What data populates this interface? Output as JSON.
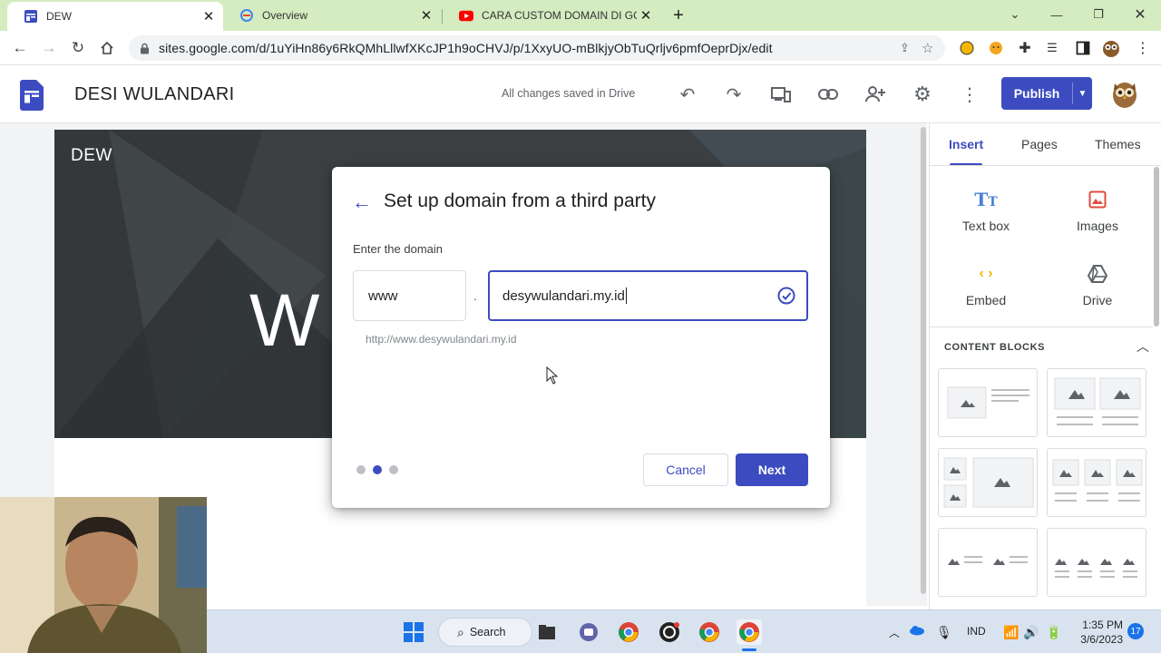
{
  "browser": {
    "tabs": [
      {
        "title": "DEW",
        "icon": "google-sites-icon"
      },
      {
        "title": "Overview",
        "icon": "google-domains-icon"
      },
      {
        "title": "CARA CUSTOM DOMAIN DI GOOGLE",
        "icon": "youtube-icon"
      }
    ],
    "new_tab_symbol": "+",
    "url": "sites.google.com/d/1uYiHn86y6RkQMhLllwfXKcJP1h9oCHVJ/p/1XxyUO-mBlkjyObTuQrljv6pmfOeprDjx/edit"
  },
  "sites": {
    "site_title": "DESI WULANDARI",
    "save_status": "All changes saved in Drive",
    "publish_label": "Publish",
    "brand_color": "#3c4cc0"
  },
  "canvas": {
    "site_logo": "DEW",
    "hero_title_fragment": "W"
  },
  "panel": {
    "tabs": [
      "Insert",
      "Pages",
      "Themes"
    ],
    "active_tab": "Insert",
    "insert_items": [
      {
        "label": "Text box",
        "icon": "text-box-icon"
      },
      {
        "label": "Images",
        "icon": "image-icon"
      },
      {
        "label": "Embed",
        "icon": "embed-code-icon"
      },
      {
        "label": "Drive",
        "icon": "drive-icon"
      }
    ],
    "section_heading": "CONTENT BLOCKS"
  },
  "dialog": {
    "title": "Set up domain from a third party",
    "subtitle": "Enter the domain",
    "subdomain_value": "www",
    "separator": ".",
    "domain_value": "desywulandari.my.id",
    "preview_url": "http://www.desywulandari.my.id",
    "cancel_label": "Cancel",
    "next_label": "Next",
    "step_current": 2,
    "step_total": 3
  },
  "taskbar": {
    "search_label": "Search",
    "language": "IND",
    "time": "1:35 PM",
    "date": "3/6/2023",
    "notification_count": "17"
  }
}
